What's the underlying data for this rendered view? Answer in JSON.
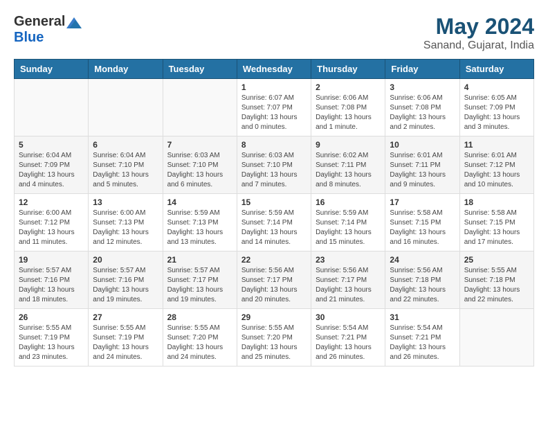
{
  "header": {
    "logo_general": "General",
    "logo_blue": "Blue",
    "month_year": "May 2024",
    "location": "Sanand, Gujarat, India"
  },
  "weekdays": [
    "Sunday",
    "Monday",
    "Tuesday",
    "Wednesday",
    "Thursday",
    "Friday",
    "Saturday"
  ],
  "weeks": [
    [
      {
        "day": "",
        "info": ""
      },
      {
        "day": "",
        "info": ""
      },
      {
        "day": "",
        "info": ""
      },
      {
        "day": "1",
        "info": "Sunrise: 6:07 AM\nSunset: 7:07 PM\nDaylight: 13 hours\nand 0 minutes."
      },
      {
        "day": "2",
        "info": "Sunrise: 6:06 AM\nSunset: 7:08 PM\nDaylight: 13 hours\nand 1 minute."
      },
      {
        "day": "3",
        "info": "Sunrise: 6:06 AM\nSunset: 7:08 PM\nDaylight: 13 hours\nand 2 minutes."
      },
      {
        "day": "4",
        "info": "Sunrise: 6:05 AM\nSunset: 7:09 PM\nDaylight: 13 hours\nand 3 minutes."
      }
    ],
    [
      {
        "day": "5",
        "info": "Sunrise: 6:04 AM\nSunset: 7:09 PM\nDaylight: 13 hours\nand 4 minutes."
      },
      {
        "day": "6",
        "info": "Sunrise: 6:04 AM\nSunset: 7:10 PM\nDaylight: 13 hours\nand 5 minutes."
      },
      {
        "day": "7",
        "info": "Sunrise: 6:03 AM\nSunset: 7:10 PM\nDaylight: 13 hours\nand 6 minutes."
      },
      {
        "day": "8",
        "info": "Sunrise: 6:03 AM\nSunset: 7:10 PM\nDaylight: 13 hours\nand 7 minutes."
      },
      {
        "day": "9",
        "info": "Sunrise: 6:02 AM\nSunset: 7:11 PM\nDaylight: 13 hours\nand 8 minutes."
      },
      {
        "day": "10",
        "info": "Sunrise: 6:01 AM\nSunset: 7:11 PM\nDaylight: 13 hours\nand 9 minutes."
      },
      {
        "day": "11",
        "info": "Sunrise: 6:01 AM\nSunset: 7:12 PM\nDaylight: 13 hours\nand 10 minutes."
      }
    ],
    [
      {
        "day": "12",
        "info": "Sunrise: 6:00 AM\nSunset: 7:12 PM\nDaylight: 13 hours\nand 11 minutes."
      },
      {
        "day": "13",
        "info": "Sunrise: 6:00 AM\nSunset: 7:13 PM\nDaylight: 13 hours\nand 12 minutes."
      },
      {
        "day": "14",
        "info": "Sunrise: 5:59 AM\nSunset: 7:13 PM\nDaylight: 13 hours\nand 13 minutes."
      },
      {
        "day": "15",
        "info": "Sunrise: 5:59 AM\nSunset: 7:14 PM\nDaylight: 13 hours\nand 14 minutes."
      },
      {
        "day": "16",
        "info": "Sunrise: 5:59 AM\nSunset: 7:14 PM\nDaylight: 13 hours\nand 15 minutes."
      },
      {
        "day": "17",
        "info": "Sunrise: 5:58 AM\nSunset: 7:15 PM\nDaylight: 13 hours\nand 16 minutes."
      },
      {
        "day": "18",
        "info": "Sunrise: 5:58 AM\nSunset: 7:15 PM\nDaylight: 13 hours\nand 17 minutes."
      }
    ],
    [
      {
        "day": "19",
        "info": "Sunrise: 5:57 AM\nSunset: 7:16 PM\nDaylight: 13 hours\nand 18 minutes."
      },
      {
        "day": "20",
        "info": "Sunrise: 5:57 AM\nSunset: 7:16 PM\nDaylight: 13 hours\nand 19 minutes."
      },
      {
        "day": "21",
        "info": "Sunrise: 5:57 AM\nSunset: 7:17 PM\nDaylight: 13 hours\nand 19 minutes."
      },
      {
        "day": "22",
        "info": "Sunrise: 5:56 AM\nSunset: 7:17 PM\nDaylight: 13 hours\nand 20 minutes."
      },
      {
        "day": "23",
        "info": "Sunrise: 5:56 AM\nSunset: 7:17 PM\nDaylight: 13 hours\nand 21 minutes."
      },
      {
        "day": "24",
        "info": "Sunrise: 5:56 AM\nSunset: 7:18 PM\nDaylight: 13 hours\nand 22 minutes."
      },
      {
        "day": "25",
        "info": "Sunrise: 5:55 AM\nSunset: 7:18 PM\nDaylight: 13 hours\nand 22 minutes."
      }
    ],
    [
      {
        "day": "26",
        "info": "Sunrise: 5:55 AM\nSunset: 7:19 PM\nDaylight: 13 hours\nand 23 minutes."
      },
      {
        "day": "27",
        "info": "Sunrise: 5:55 AM\nSunset: 7:19 PM\nDaylight: 13 hours\nand 24 minutes."
      },
      {
        "day": "28",
        "info": "Sunrise: 5:55 AM\nSunset: 7:20 PM\nDaylight: 13 hours\nand 24 minutes."
      },
      {
        "day": "29",
        "info": "Sunrise: 5:55 AM\nSunset: 7:20 PM\nDaylight: 13 hours\nand 25 minutes."
      },
      {
        "day": "30",
        "info": "Sunrise: 5:54 AM\nSunset: 7:21 PM\nDaylight: 13 hours\nand 26 minutes."
      },
      {
        "day": "31",
        "info": "Sunrise: 5:54 AM\nSunset: 7:21 PM\nDaylight: 13 hours\nand 26 minutes."
      },
      {
        "day": "",
        "info": ""
      }
    ]
  ]
}
